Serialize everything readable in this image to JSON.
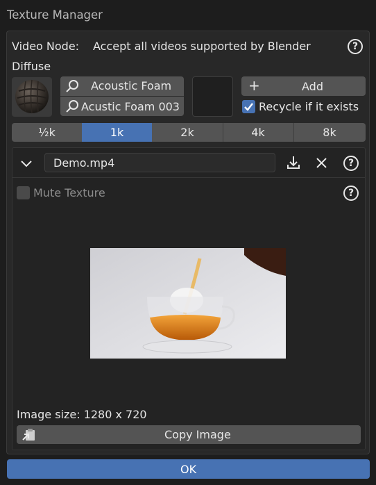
{
  "window": {
    "title": "Texture Manager"
  },
  "video_node": {
    "label": "Video Node:",
    "value": "Accept all videos supported by Blender"
  },
  "section": {
    "diffuse_label": "Diffuse"
  },
  "material": {
    "name": "Acoustic Foam",
    "variant": "Acustic Foam 003"
  },
  "actions": {
    "add_label": "Add",
    "recycle_label": "Recycle if it exists",
    "recycle_checked": true
  },
  "resolutions": {
    "items": [
      "½k",
      "1k",
      "2k",
      "4k",
      "8k"
    ],
    "selected": "1k"
  },
  "file": {
    "name": "Demo.mp4"
  },
  "mute": {
    "label": "Mute Texture",
    "checked": false
  },
  "image": {
    "size_text": "Image size: 1280 x 720"
  },
  "buttons": {
    "copy_image": "Copy Image",
    "ok": "OK"
  },
  "icons": {
    "help": "question-mark-circle",
    "download": "download-icon",
    "close": "close-icon",
    "collapse": "chevron-down-icon",
    "search": "magnifier-icon",
    "paste": "clipboard-icon"
  },
  "colors": {
    "accent": "#4772b3",
    "panel": "#282828",
    "background": "#1d1d1d",
    "button": "#545454"
  }
}
